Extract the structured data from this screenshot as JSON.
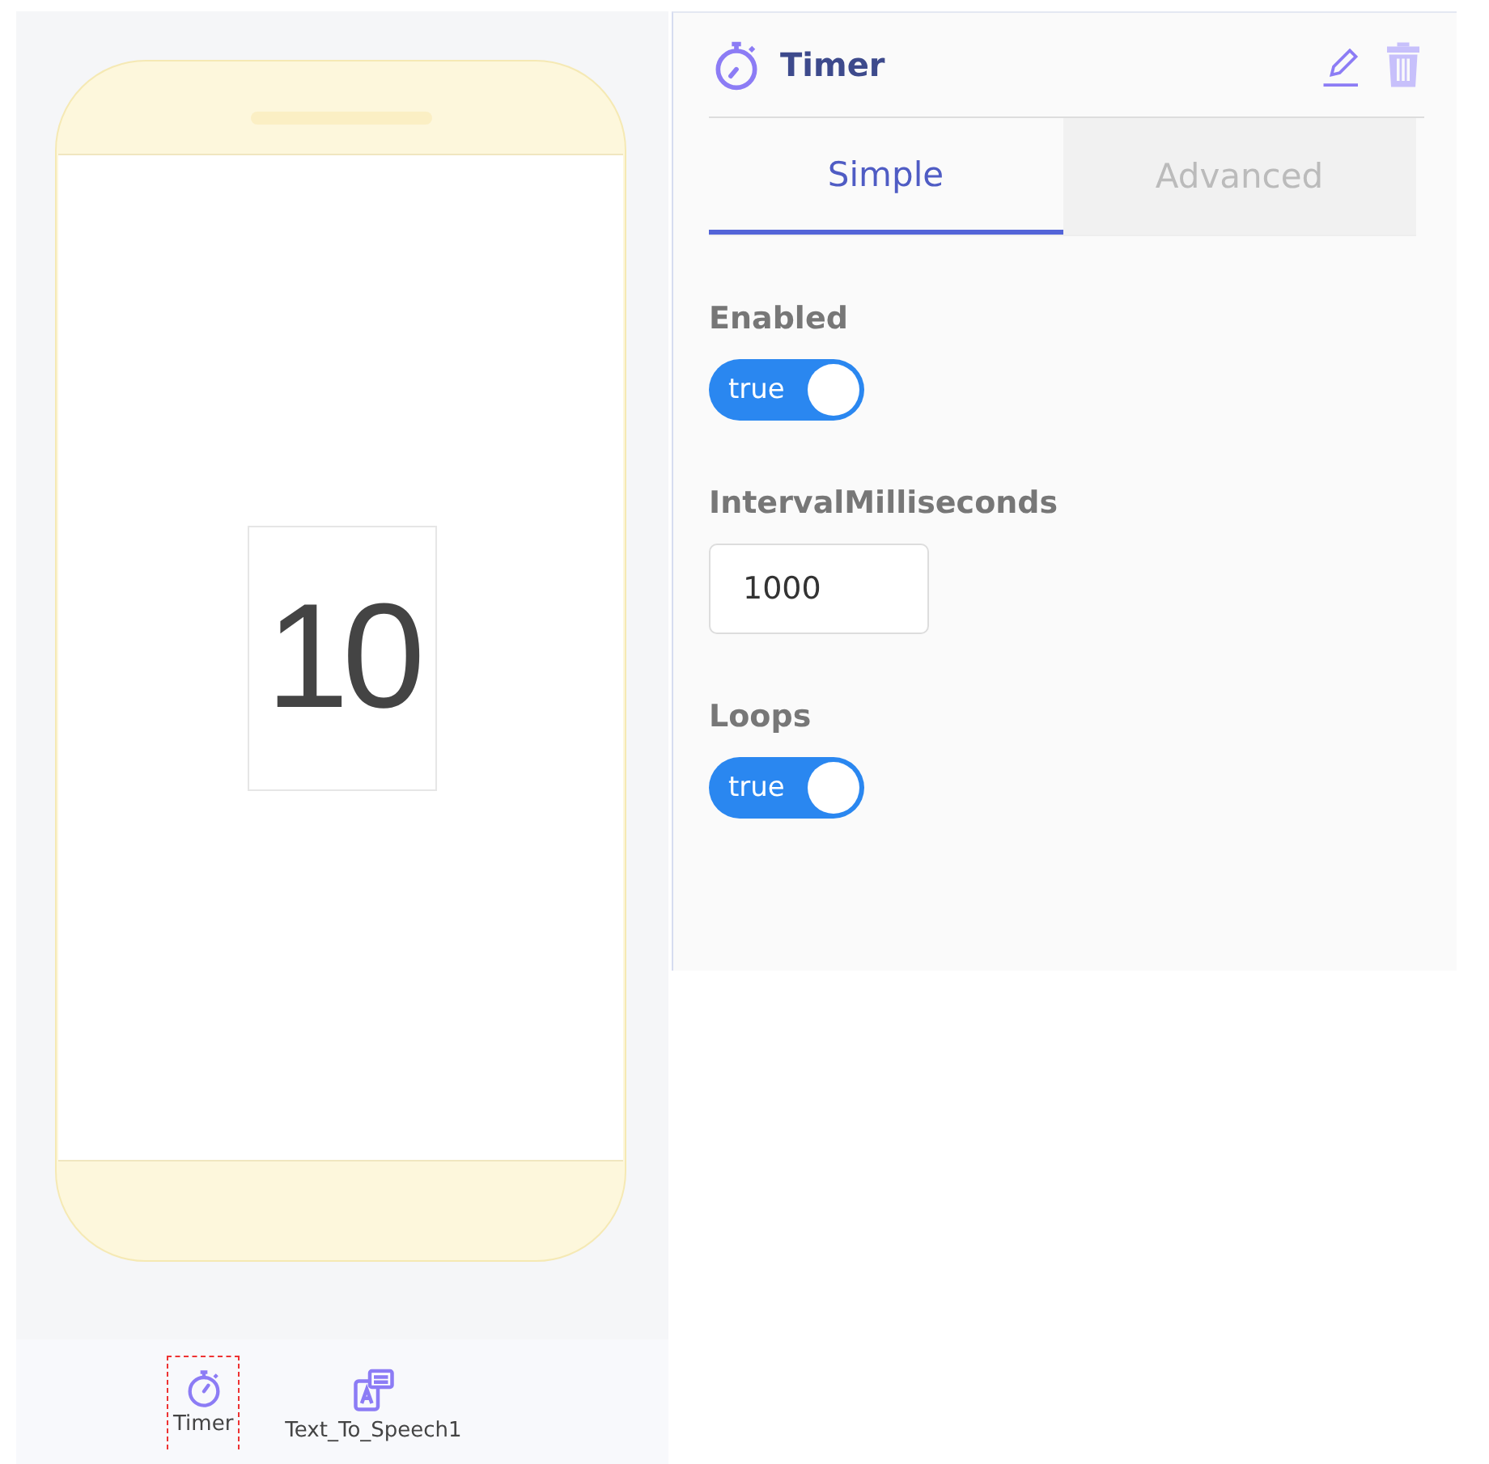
{
  "designer": {
    "screen_label": "10",
    "components": [
      {
        "name": "Timer",
        "kind": "timer",
        "selected": true
      },
      {
        "name": "Text_To_Speech1",
        "kind": "speech",
        "selected": false
      }
    ]
  },
  "properties": {
    "title": "Timer",
    "tabs": [
      {
        "label": "Simple",
        "selected": true
      },
      {
        "label": "Advanced",
        "selected": false
      }
    ],
    "items": [
      {
        "kind": "toggle",
        "label": "Enabled",
        "on": true,
        "value": "true"
      },
      {
        "kind": "number",
        "label": "IntervalMilliseconds",
        "value": "1000"
      },
      {
        "kind": "toggle",
        "label": "Loops",
        "on": true,
        "value": "true"
      }
    ]
  }
}
